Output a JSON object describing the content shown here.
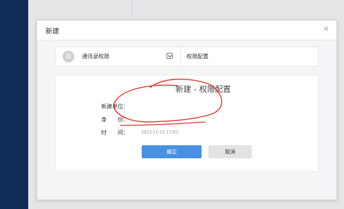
{
  "dialog": {
    "title": "新建",
    "close_symbol": "×"
  },
  "tabs": {
    "left": {
      "avatar_text": "圆",
      "label": "通讯录权限"
    },
    "right": {
      "label": "权限配置"
    }
  },
  "form": {
    "heading": "新建 - 权限配置",
    "fields": {
      "unit_label": "新建单位：",
      "identity_label": "身　　份：",
      "time_label": "时　　间：",
      "time_value": "2023-11-15 17:03"
    }
  },
  "buttons": {
    "confirm": "确定",
    "cancel": "取消"
  },
  "annotation": {
    "color": "#d9342b"
  },
  "theme": {
    "nav_color": "#0e2c56",
    "primary": "#4a90e2"
  },
  "icons": {
    "close": "close-icon",
    "toggle": "collapse-toggle-icon",
    "avatar": "avatar-icon"
  }
}
